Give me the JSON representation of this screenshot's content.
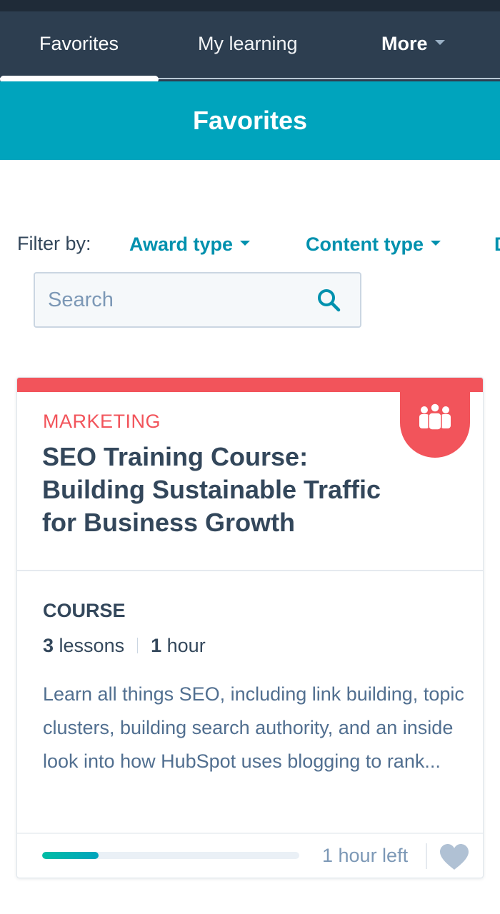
{
  "nav": {
    "tabs": [
      {
        "label": "Favorites",
        "active": true
      },
      {
        "label": "My learning",
        "active": false
      },
      {
        "label": "More",
        "active": false
      }
    ]
  },
  "banner": {
    "title": "Favorites"
  },
  "filters": {
    "label": "Filter by:",
    "award_type": "Award type",
    "content_type": "Content type",
    "cut_off": "D"
  },
  "search": {
    "placeholder": "Search"
  },
  "card": {
    "category": "MARKETING",
    "title": "SEO Training Course: Building Sustainable Traffic for Business Growth",
    "type": "COURSE",
    "lessons_count": "3",
    "lessons_label": "lessons",
    "duration_value": "1",
    "duration_unit": "hour",
    "description": "Learn all things SEO, including link building, topic clusters, building search authority, and an inside look into how HubSpot uses blogging to rank...",
    "progress_percent": 22,
    "time_left": "1 hour left",
    "badge_icon": "group-icon",
    "favorite_icon": "heart-icon"
  },
  "colors": {
    "nav_bg": "#2d3e50",
    "banner_bg": "#00a4bd",
    "accent_teal": "#0091ae",
    "category_red": "#f2545b",
    "progress": "#00bda5"
  }
}
